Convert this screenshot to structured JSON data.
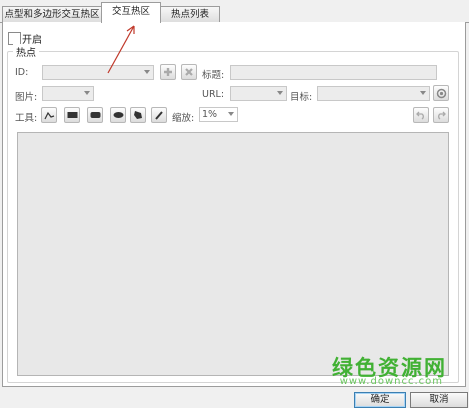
{
  "tabs": [
    {
      "label": "点型和多边形交互热区"
    },
    {
      "label": "交互热区"
    },
    {
      "label": "热点列表"
    }
  ],
  "enable": {
    "label": "开启",
    "checked": false
  },
  "group": {
    "title": "热点"
  },
  "form": {
    "id_label": "ID:",
    "title_label": "标题:",
    "image_label": "图片:",
    "url_label": "URL:",
    "target_label": "目标:",
    "tools_label": "工具:",
    "zoom_label": "缩放:",
    "zoom_value": "1%"
  },
  "footer": {
    "ok": "确定",
    "cancel": "取消"
  },
  "watermark": {
    "main": "绿色资源网",
    "url": "www.downcc.com"
  },
  "colors": {
    "arrow": "#c0392b",
    "watermark": "#41b134"
  }
}
